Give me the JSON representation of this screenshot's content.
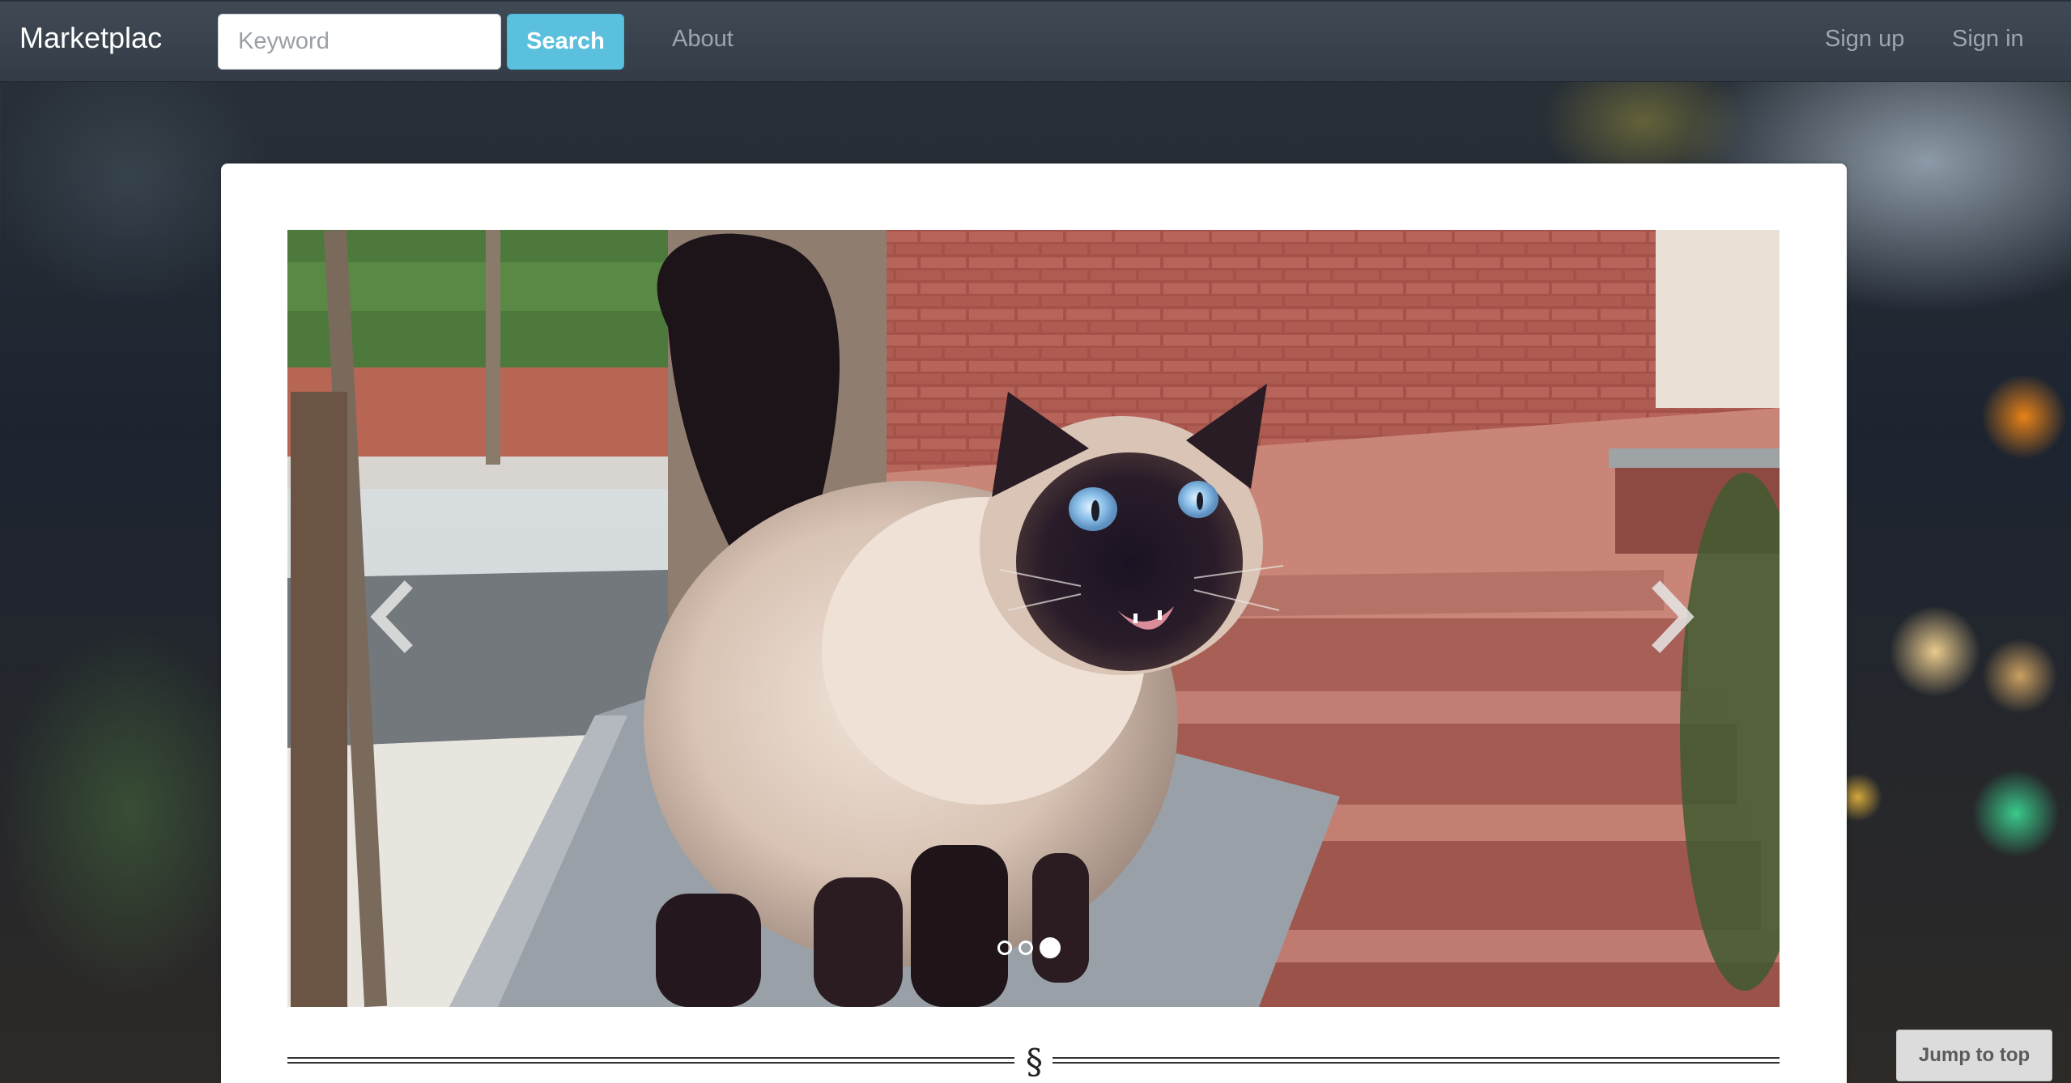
{
  "navbar": {
    "brand": "Marketplac",
    "search_placeholder": "Keyword",
    "search_value": "",
    "search_button": "Search",
    "about_link": "About",
    "signup_link": "Sign up",
    "signin_link": "Sign in"
  },
  "carousel": {
    "prev_icon": "chevron-left-icon",
    "next_icon": "chevron-right-icon",
    "slide_count": 3,
    "active_slide": 3
  },
  "divider": {
    "glyph": "§"
  },
  "jump_to_top": "Jump to top",
  "colors": {
    "navbar": "#3a434d",
    "search_button": "#5bc0de",
    "nav_link": "#9da6ae",
    "panel": "#ffffff"
  }
}
